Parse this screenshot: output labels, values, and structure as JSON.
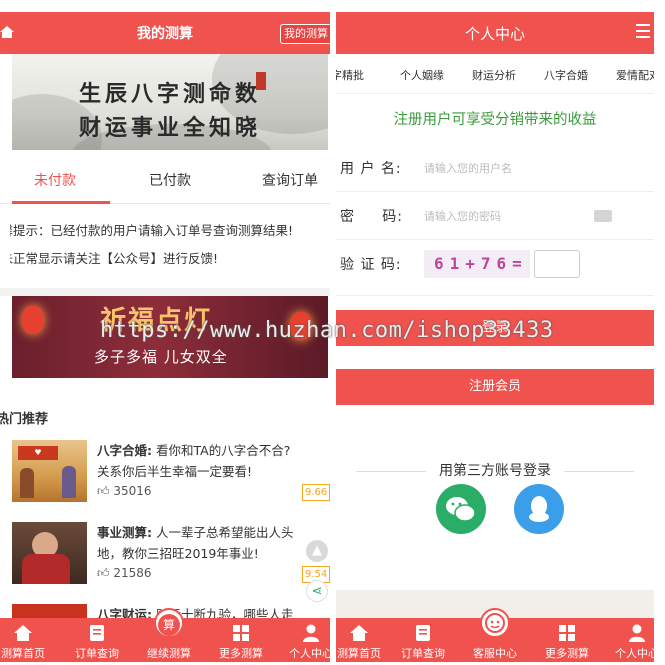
{
  "left": {
    "header": {
      "title": "我的测算",
      "tag": "我的测算"
    },
    "banner1": {
      "line1": "生辰八字测命数",
      "line2": "财运事业全知晓"
    },
    "tabs": [
      {
        "label": "未付款",
        "active": true
      },
      {
        "label": "已付款",
        "active": false
      },
      {
        "label": "查询订单",
        "active": false
      }
    ],
    "notice": {
      "line1": "温馨提示：已经付款的用户请输入订单号查询测算结果!",
      "line2": "如未正常显示请关注【公众号】进行反馈!"
    },
    "banner2": {
      "title": "祈福点灯",
      "subtitle": "多子多福  儿女双全"
    },
    "watermark": "https://www.huzhan.com/ishop33433",
    "section_title": "热门推荐",
    "recommendations": [
      {
        "name": "八字合婚:",
        "desc1": "看你和TA的八字合不合?",
        "desc2": "关系你后半生幸福一定要看!",
        "likes": "35016",
        "badge": "9.66"
      },
      {
        "name": "事业测算:",
        "desc1": "人一辈子总希望能出人头",
        "desc2": "地，教你三招旺2019年事业!",
        "likes": "21586",
        "badge": "9.54"
      },
      {
        "name": "八字财运:",
        "desc1": "财运十断九验，哪些人走",
        "desc2": "",
        "likes": "",
        "badge": ""
      }
    ],
    "bottom_nav": [
      {
        "label": "测算首页",
        "icon": "home-icon"
      },
      {
        "label": "订单查询",
        "icon": "order-icon"
      },
      {
        "label": "继续测算",
        "icon": "calculate-icon",
        "center_glyph": "算"
      },
      {
        "label": "更多测算",
        "icon": "grid-icon"
      },
      {
        "label": "个人中心",
        "icon": "user-icon"
      }
    ]
  },
  "right": {
    "header": {
      "title": "个人中心"
    },
    "categories": [
      "八字精批",
      "个人姻缘",
      "财运分析",
      "八字合婚",
      "爱情配对"
    ],
    "promo": "注册用户可享受分销带来的收益",
    "form": {
      "username_label": "用 户 名:",
      "username_placeholder": "请输入您的用户名",
      "password_label": "密     码:",
      "password_placeholder": "请输入您的密码",
      "captcha_label": "验 证 码:",
      "captcha_text": "61+76="
    },
    "login_button": "登录",
    "register_button": "注册会员",
    "third_party_title": "用第三方账号登录",
    "bottom_nav": [
      {
        "label": "测算首页",
        "icon": "home-icon"
      },
      {
        "label": "订单查询",
        "icon": "order-icon"
      },
      {
        "label": "客服中心",
        "icon": "support-icon"
      },
      {
        "label": "更多测算",
        "icon": "grid-icon"
      },
      {
        "label": "个人中心",
        "icon": "user-icon"
      }
    ]
  },
  "colors": {
    "brand_red": "#f0524e",
    "promo_green": "#3a9b3a",
    "wechat_green": "#2aae67",
    "qq_blue": "#3a9ee8",
    "badge_orange": "#f5a623"
  }
}
